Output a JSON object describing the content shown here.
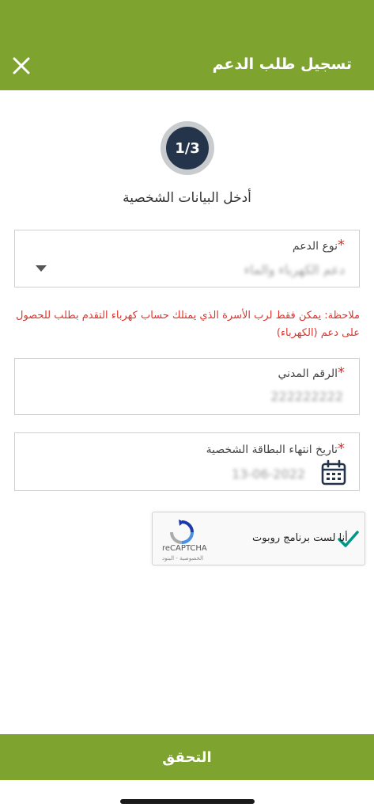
{
  "header": {
    "title": "تسجيل طلب الدعم",
    "close_icon": "close-icon",
    "color": "#7ea32f"
  },
  "stepper": {
    "label": "1/3",
    "current": 1,
    "total": 3
  },
  "section": {
    "title": "أدخل البيانات الشخصية"
  },
  "support_type": {
    "label": "نوع الدعم",
    "required_mark": "*",
    "value": "دعم الكهرباء والماء",
    "icon": "chevron-down-icon"
  },
  "note": {
    "text": "ملاحظة: يمكن فقط لرب الأسرة الذي يمتلك حساب كهرباء التقدم بطلب للحصول على دعم (الكهرباء)"
  },
  "civil_id": {
    "label": "الرقم المدني",
    "required_mark": "*",
    "value": "222222222"
  },
  "id_expiry": {
    "label": "تاريخ انتهاء البطاقة الشخصية",
    "required_mark": "*",
    "value": "13-06-2022",
    "icon": "calendar-icon"
  },
  "recaptcha": {
    "checkbox_label": "أنا لست برنامج روبوت",
    "brand": "reCAPTCHA",
    "links": "الخصوصية - البنود",
    "checked": true
  },
  "footer": {
    "verify_label": "التحقق"
  },
  "colors": {
    "accent": "#7ea32f",
    "step_circle": "#24344a",
    "required": "#e0332b",
    "check": "#009688"
  }
}
